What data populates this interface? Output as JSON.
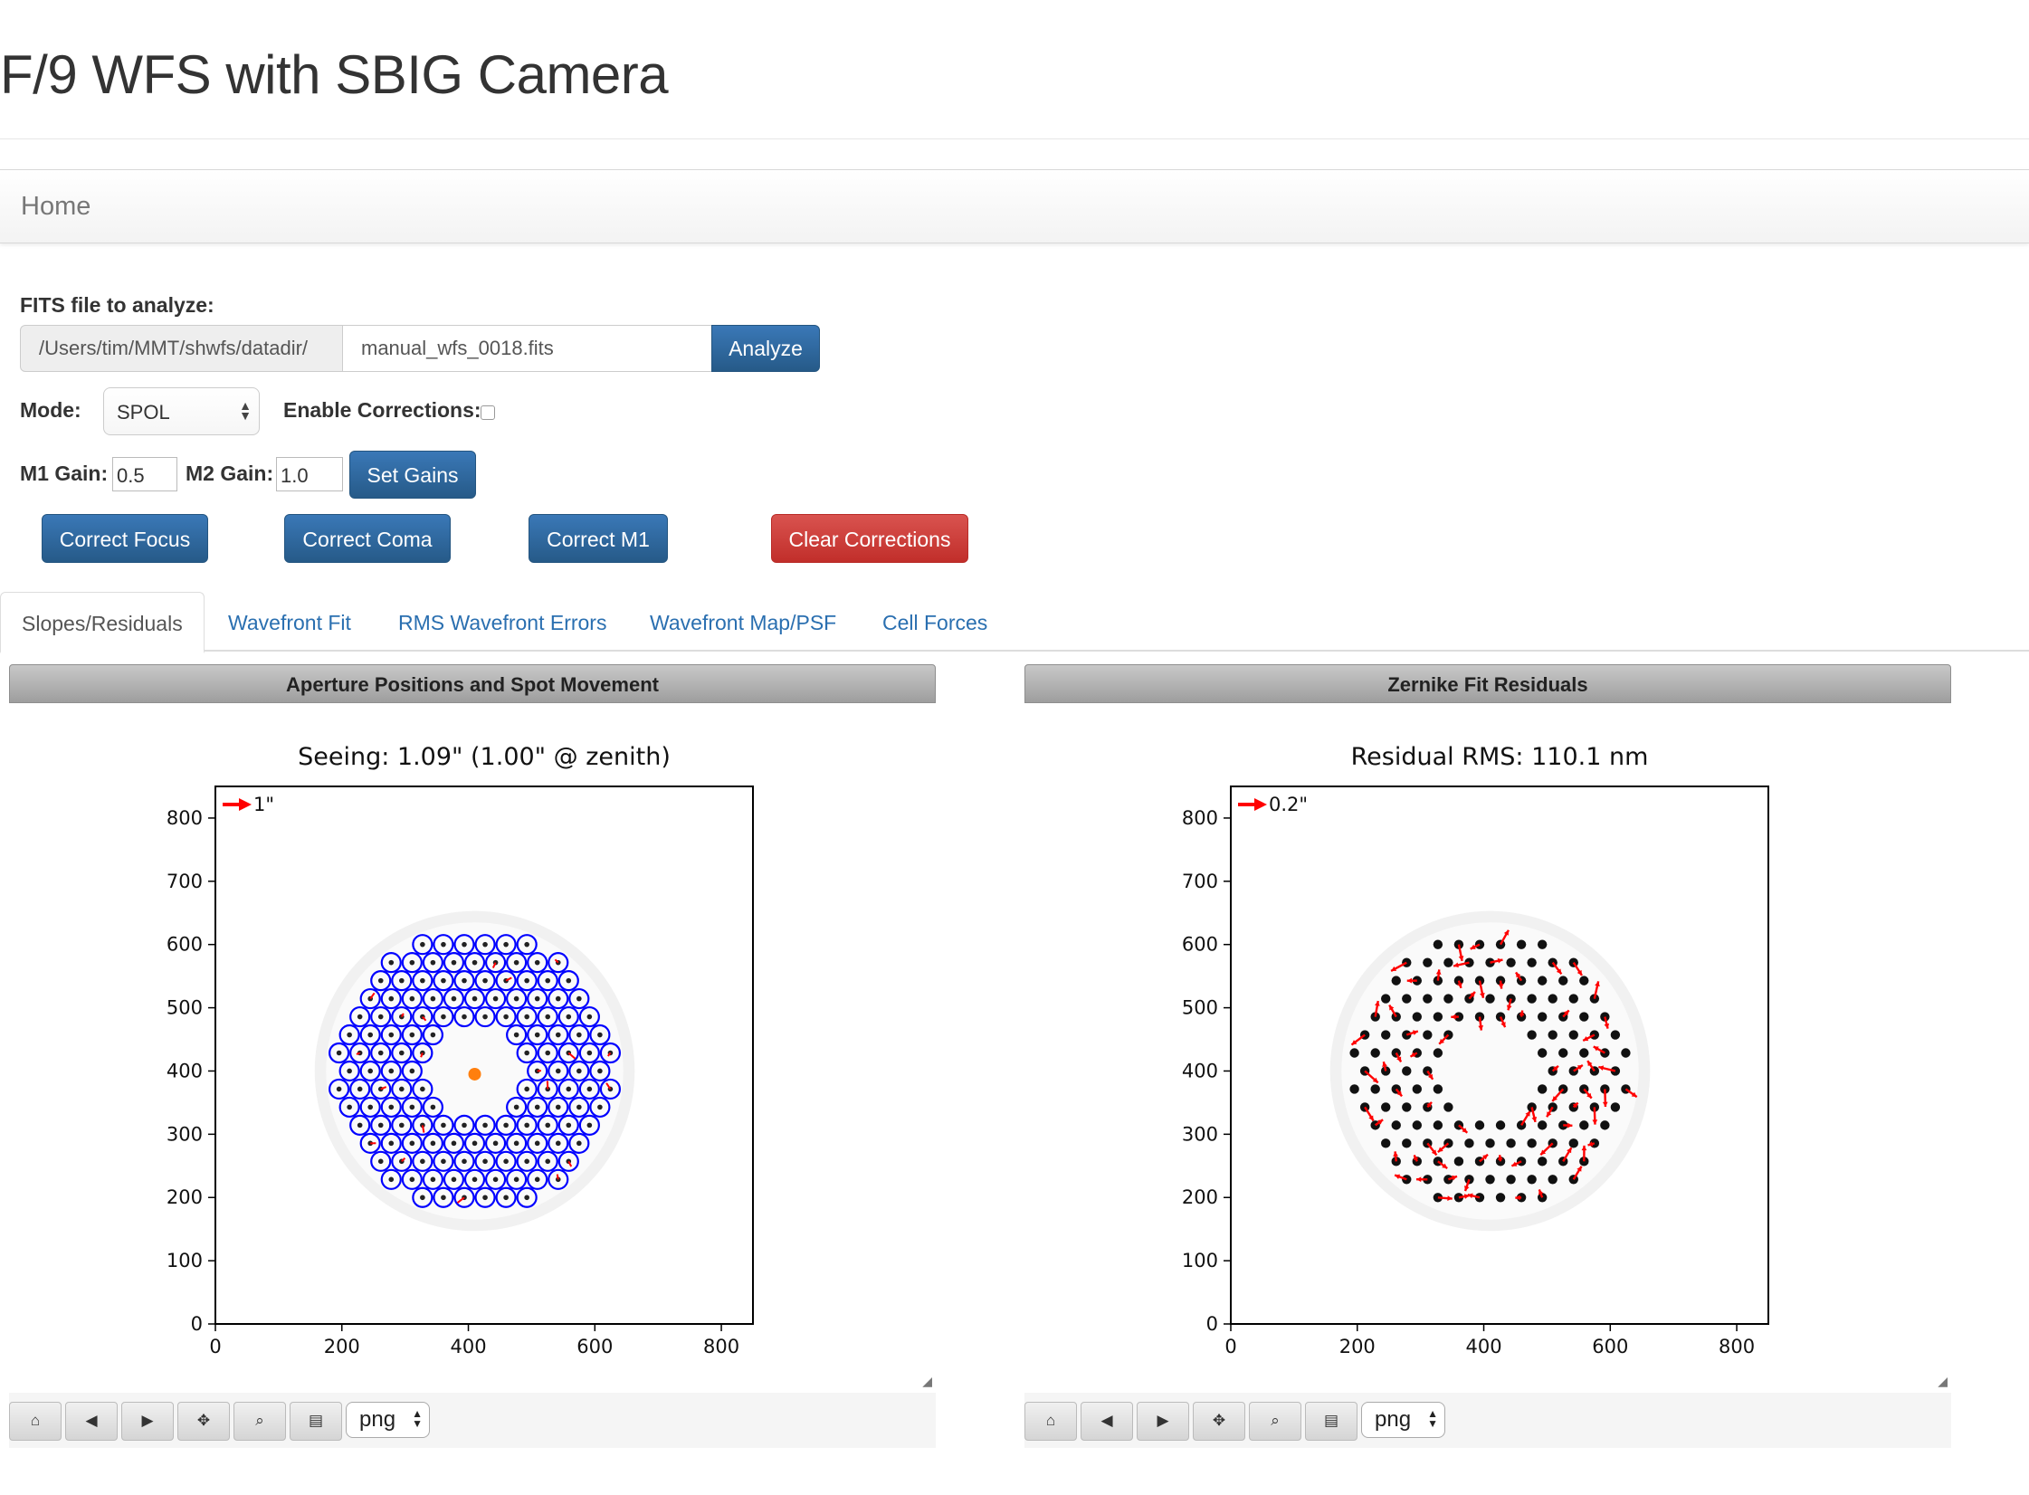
{
  "page": {
    "title": "F/9 WFS with SBIG Camera",
    "nav_home": "Home"
  },
  "form": {
    "fits_label": "FITS file to analyze:",
    "datadir": "/Users/tim/MMT/shwfs/datadir/",
    "filename": "manual_wfs_0018.fits",
    "analyze_label": "Analyze",
    "mode_label": "Mode:",
    "mode_value": "SPOL",
    "enable_corrections_label": "Enable Corrections:",
    "enable_corrections_checked": false,
    "m1_gain_label": "M1 Gain:",
    "m1_gain_value": "0.5",
    "m2_gain_label": "M2 Gain:",
    "m2_gain_value": "1.0",
    "set_gains_label": "Set Gains"
  },
  "actions": {
    "correct_focus": "Correct Focus",
    "correct_coma": "Correct Coma",
    "correct_m1": "Correct M1",
    "clear_corrections": "Clear Corrections"
  },
  "tabs": [
    {
      "label": "Slopes/Residuals",
      "active": true
    },
    {
      "label": "Wavefront Fit",
      "active": false
    },
    {
      "label": "RMS Wavefront Errors",
      "active": false
    },
    {
      "label": "Wavefront Map/PSF",
      "active": false
    },
    {
      "label": "Cell Forces",
      "active": false
    }
  ],
  "panels": [
    {
      "header": "Aperture Positions and Spot Movement"
    },
    {
      "header": "Zernike Fit Residuals"
    }
  ],
  "toolbar": {
    "icons": [
      "home-icon",
      "back-icon",
      "forward-icon",
      "pan-icon",
      "zoom-icon",
      "save-icon"
    ],
    "format": "png"
  },
  "colors": {
    "primary_button": "#2e6da4",
    "danger_button": "#d9534f",
    "link": "#2a6fb0",
    "aperture_circles": "#0000ff",
    "vectors": "#ff0000",
    "center_marker": "#ff7f0e"
  },
  "chart_data": [
    {
      "type": "scatter",
      "title": "Seeing: 1.09\" (1.00\" @ zenith)",
      "xlabel": "",
      "ylabel": "",
      "xlim": [
        0,
        850
      ],
      "ylim": [
        0,
        850
      ],
      "xticks": [
        0,
        200,
        400,
        600,
        800
      ],
      "yticks": [
        0,
        100,
        200,
        300,
        400,
        500,
        600,
        700,
        800
      ],
      "legend_text": "1\"",
      "center_marker": [
        410,
        395
      ],
      "pupil_outer_radius": 245,
      "pupil_inner_radius": 75,
      "spot_pitch": 33,
      "grid": false
    },
    {
      "type": "scatter",
      "title": "Residual RMS: 110.1 nm",
      "xlabel": "",
      "ylabel": "",
      "xlim": [
        0,
        850
      ],
      "ylim": [
        0,
        850
      ],
      "xticks": [
        0,
        200,
        400,
        600,
        800
      ],
      "yticks": [
        0,
        100,
        200,
        300,
        400,
        500,
        600,
        700,
        800
      ],
      "legend_text": "0.2\"",
      "pupil_outer_radius": 245,
      "pupil_inner_radius": 75,
      "spot_pitch": 33,
      "grid": false
    }
  ]
}
